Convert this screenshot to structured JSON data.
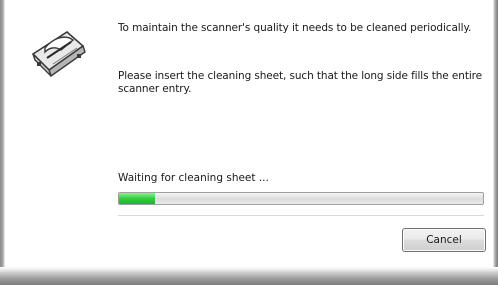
{
  "dialog": {
    "icon": "scanner-icon",
    "message_1": "To maintain the scanner's quality it needs to be cleaned periodically.",
    "message_2": "Please insert the cleaning sheet, such that the long side fills the entire scanner entry.",
    "status_text": "Waiting for cleaning sheet ...",
    "progress_fraction": 0.1,
    "progress_color": "#2fd040",
    "cancel_label": "Cancel"
  }
}
